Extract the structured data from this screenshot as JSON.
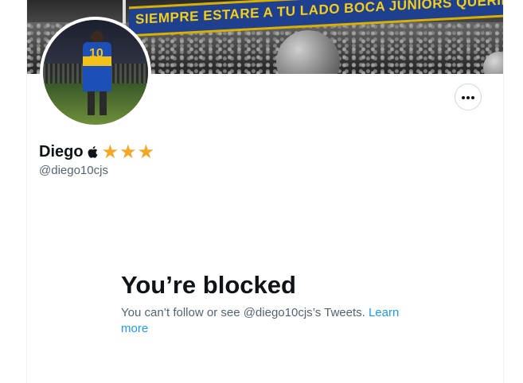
{
  "banner": {
    "flag_text": "SIEMPRE ESTARE A TU LADO BOCA JUNIORS QUERIDO"
  },
  "profile": {
    "name": "Diego",
    "badge_icon": "apple-icon",
    "stars": [
      "★",
      "★",
      "★"
    ],
    "star_color": "#f5a623",
    "handle": "@diego10cjs",
    "more_icon": "more-dots-icon"
  },
  "blocked": {
    "title": "You’re blocked",
    "message": "You can’t follow or see @diego10cjs’s Tweets. ",
    "link_label": "Learn more",
    "link_color": "#1d9bf0"
  }
}
